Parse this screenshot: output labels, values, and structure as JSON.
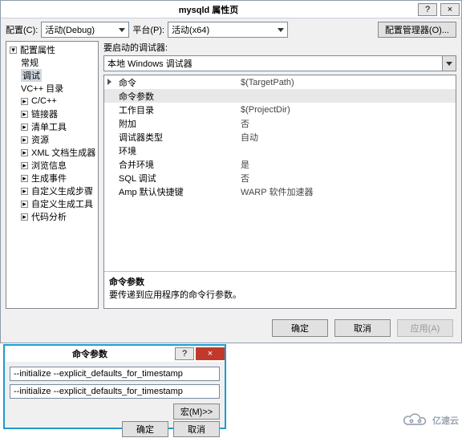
{
  "main": {
    "title": "mysqld 属性页",
    "help_btn": "?",
    "close_btn": "×",
    "config_label": "配置(C):",
    "config_value": "活动(Debug)",
    "platform_label": "平台(P):",
    "platform_value": "活动(x64)",
    "config_mgr": "配置管理器(O)..."
  },
  "tree": {
    "root": "配置属性",
    "items": [
      "常规",
      "调试",
      "VC++ 目录",
      "C/C++",
      "链接器",
      "清单工具",
      "资源",
      "XML 文档生成器",
      "浏览信息",
      "生成事件",
      "自定义生成步骤",
      "自定义生成工具",
      "代码分析"
    ],
    "selected": "调试"
  },
  "rightPanel": {
    "launch_label": "要启动的调试器:",
    "debugger": "本地 Windows 调试器",
    "props": [
      {
        "name": "命令",
        "value": "$(TargetPath)"
      },
      {
        "name": "命令参数",
        "value": ""
      },
      {
        "name": "工作目录",
        "value": "$(ProjectDir)"
      },
      {
        "name": "附加",
        "value": "否"
      },
      {
        "name": "调试器类型",
        "value": "自动"
      },
      {
        "name": "环境",
        "value": ""
      },
      {
        "name": "合并环境",
        "value": "是"
      },
      {
        "name": "SQL 调试",
        "value": "否"
      },
      {
        "name": "Amp 默认快捷键",
        "value": "WARP 软件加速器"
      }
    ],
    "selected_prop_index": 1,
    "desc_title": "命令参数",
    "desc_text": "要传递到应用程序的命令行参数。"
  },
  "buttons": {
    "ok": "确定",
    "cancel": "取消",
    "apply": "应用(A)"
  },
  "dlg2": {
    "title": "命令参数",
    "help_btn": "?",
    "close_btn": "×",
    "input1": "--initialize --explicit_defaults_for_timestamp",
    "input2": "--initialize --explicit_defaults_for_timestamp",
    "macro_btn": "宏(M)>>",
    "ok": "确定",
    "cancel": "取消"
  },
  "watermark": "亿速云"
}
